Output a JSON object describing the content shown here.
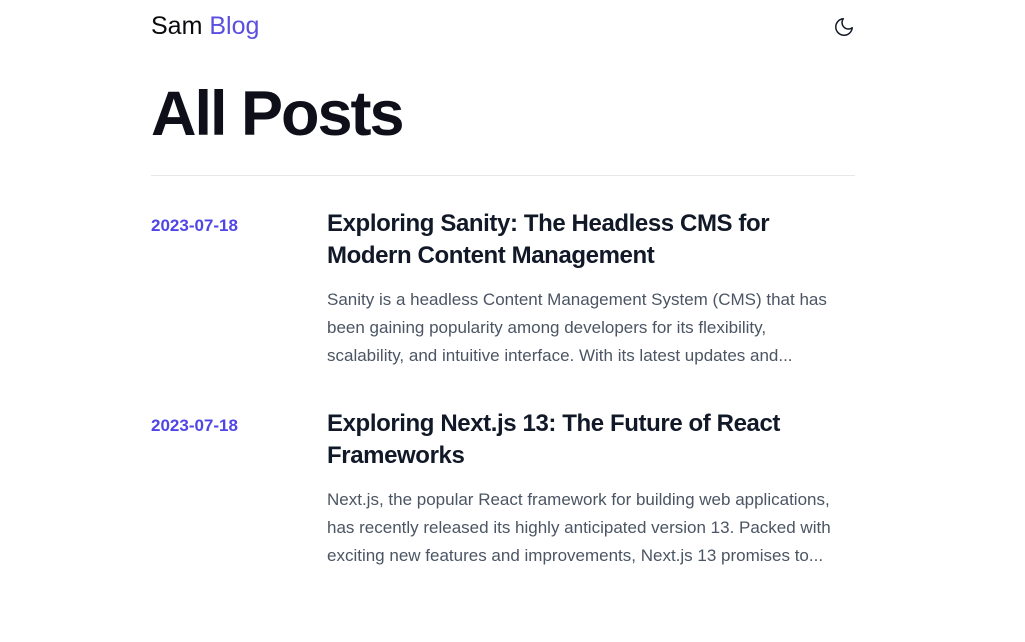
{
  "header": {
    "brand_first": "Sam",
    "brand_second": "Blog",
    "theme_icon": "moon-icon",
    "accent_color": "#5b4fe0"
  },
  "page": {
    "title": "All Posts"
  },
  "posts": [
    {
      "date": "2023-07-18",
      "title": "Exploring Sanity: The Headless CMS for Modern Content Management",
      "excerpt": "Sanity is a headless Content Management System (CMS) that has been gaining popularity among developers for its flexibility, scalability, and intuitive interface. With its latest updates and..."
    },
    {
      "date": "2023-07-18",
      "title": "Exploring Next.js 13: The Future of React Frameworks",
      "excerpt": "Next.js, the popular React framework for building web applications, has recently released its highly anticipated version 13. Packed with exciting new features and improvements, Next.js 13 promises to..."
    }
  ]
}
